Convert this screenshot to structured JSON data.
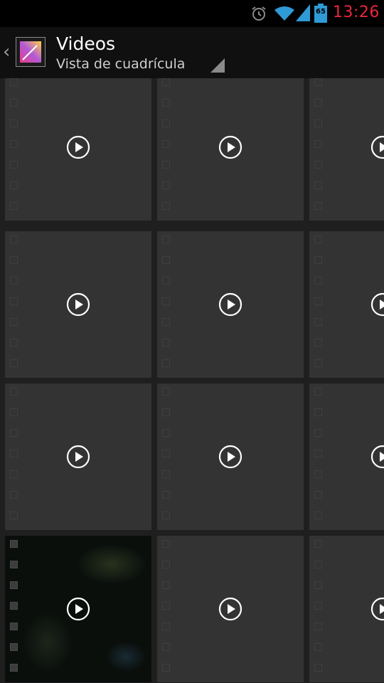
{
  "status_bar": {
    "time": "13:26",
    "battery_level": "65",
    "icons": [
      "alarm-icon",
      "wifi-icon",
      "signal-icon",
      "battery-icon"
    ],
    "time_color": "#e8263d"
  },
  "action_bar": {
    "title": "Videos",
    "subtitle": "Vista de cuadrícula",
    "icons": [
      "back-chevron-icon",
      "gallery-app-icon",
      "spinner-triangle-icon"
    ]
  },
  "grid": {
    "tiles": [
      {
        "type": "video",
        "thumbnail": "placeholder",
        "icon": "play-icon"
      },
      {
        "type": "video",
        "thumbnail": "placeholder",
        "icon": "play-icon"
      },
      {
        "type": "video",
        "thumbnail": "placeholder",
        "icon": "play-icon"
      },
      {
        "type": "video",
        "thumbnail": "placeholder",
        "icon": "play-icon"
      },
      {
        "type": "video",
        "thumbnail": "placeholder",
        "icon": "play-icon"
      },
      {
        "type": "video",
        "thumbnail": "placeholder",
        "icon": "play-icon"
      },
      {
        "type": "video",
        "thumbnail": "placeholder",
        "icon": "play-icon"
      },
      {
        "type": "video",
        "thumbnail": "placeholder",
        "icon": "play-icon"
      },
      {
        "type": "video",
        "thumbnail": "placeholder",
        "icon": "play-icon"
      },
      {
        "type": "video",
        "thumbnail": "dark-frame",
        "icon": "play-icon"
      },
      {
        "type": "video",
        "thumbnail": "placeholder",
        "icon": "play-icon"
      },
      {
        "type": "video",
        "thumbnail": "placeholder",
        "icon": "play-icon"
      }
    ]
  }
}
